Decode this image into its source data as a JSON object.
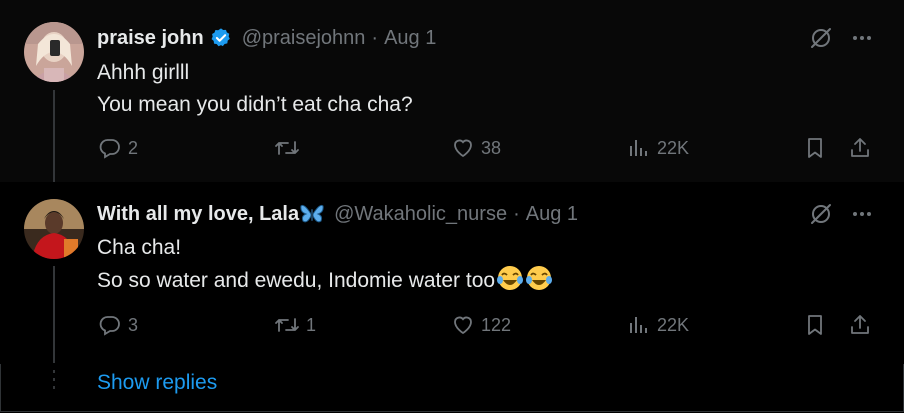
{
  "tweets": [
    {
      "name": "praise john",
      "handle": "@praisejohnn",
      "separator": "·",
      "date": "Aug 1",
      "lines": [
        "Ahhh girlll",
        "You mean you didn’t eat cha cha?"
      ],
      "replies": "2",
      "retweets": "",
      "likes": "38",
      "views": "22K"
    },
    {
      "name": "With all my love, Lala",
      "handle": "@Wakaholic_nurse",
      "separator": "·",
      "date": "Aug 1",
      "lines": [
        "Cha cha!",
        "So so water and ewedu, Indomie water too"
      ],
      "replies": "3",
      "retweets": "1",
      "likes": "122",
      "views": "22K"
    }
  ],
  "show_replies_label": "Show replies",
  "icons": {
    "reply": "reply-icon",
    "retweet": "retweet-icon",
    "like": "heart-icon",
    "views": "views-icon",
    "bookmark": "bookmark-icon",
    "share": "share-icon",
    "grok": "grok-icon",
    "more": "more-icon",
    "verified": "verified-badge-icon",
    "butterfly": "butterfly-emoji-icon",
    "laughing": "tears-of-joy-emoji-icon"
  },
  "colors": {
    "background": "#000000",
    "text": "#e7e9ea",
    "secondary": "#71767b",
    "link": "#1d9bf0",
    "verified": "#1d9bf0"
  }
}
